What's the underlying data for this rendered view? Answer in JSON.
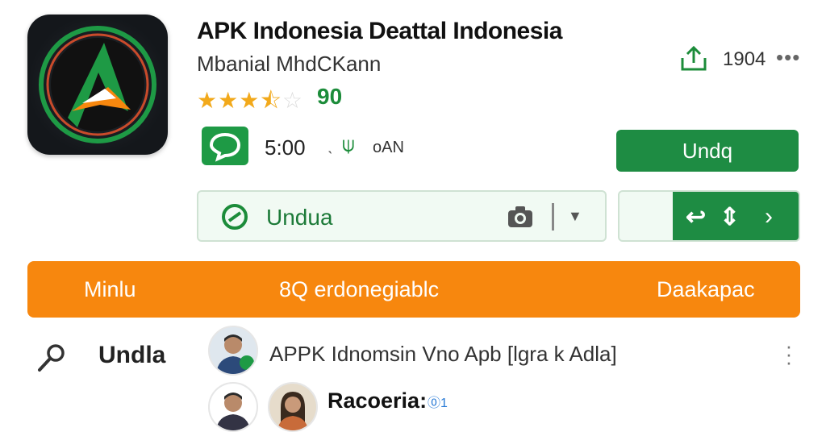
{
  "app": {
    "title": "APK Indonesia Deattal Indonesia",
    "developer": "Mbanial MhdCKann",
    "rating_stars": 3.5,
    "rating_value": "90",
    "share_count": "1904",
    "more_symbol": "•••"
  },
  "meta_row": {
    "time": "5:00",
    "dot": "ˎ",
    "size": "oAN"
  },
  "primary_button": {
    "label": "Undq"
  },
  "download_field": {
    "label": "Undua"
  },
  "orange_bar": {
    "left": "Minlu",
    "center": "8Q erdonegiablc",
    "right": "Daakapac"
  },
  "list": {
    "search_label": "Undla",
    "row1_text": "APPK Idnomsin Vno Apb  [lgra k Adla]",
    "row2_label": "Racoeria:",
    "row2_badge": "⓪1"
  },
  "colors": {
    "brand_green": "#1e8c43",
    "orange": "#f7870e",
    "star": "#f2a91b"
  }
}
